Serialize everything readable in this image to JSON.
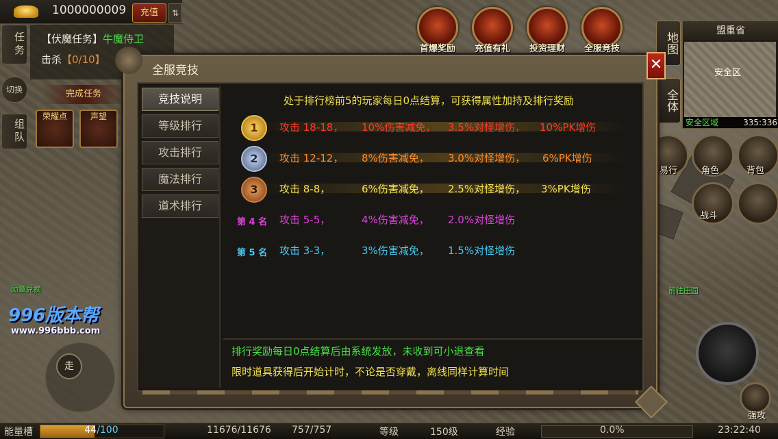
{
  "hud": {
    "gold_amount": "1000000009",
    "recharge_label": "充值",
    "swap_icon": "⇅"
  },
  "quest": {
    "side_tabs": [
      "任务",
      "切换",
      "组队"
    ],
    "title_prefix": "【伏魔任务】",
    "title_target": "牛魔侍卫",
    "kill_label": "击杀",
    "kill_count": "【0/10】",
    "complete_label": "完成任务",
    "icon1": "荣耀点",
    "icon2": "声望"
  },
  "activities": [
    {
      "label": "首爆奖励",
      "icon": "first-drop-icon"
    },
    {
      "label": "充值有礼",
      "icon": "recharge-gift-icon"
    },
    {
      "label": "投资理财",
      "icon": "invest-icon"
    },
    {
      "label": "全服竞技",
      "icon": "server-arena-icon"
    }
  ],
  "minimap": {
    "side_buttons": [
      "地图",
      "全体"
    ],
    "region_name": "盟重省",
    "safe_label": "安全区",
    "zone_status": "安全区域",
    "coords": "335:336"
  },
  "right_buttons": [
    "交易行",
    "角色",
    "背包",
    "战斗",
    "强攻"
  ],
  "walk_label": "走",
  "npcs": {
    "left": "勋章兑换",
    "right": "前往庄园"
  },
  "logo": {
    "main": "996版本帮",
    "sub": "www.996bbb.com"
  },
  "status_bar": {
    "energy_label": "能量槽",
    "energy_current": "44",
    "energy_max": "/100",
    "energy_fraction": 0.44,
    "hp": "11676/11676",
    "mp": "757/757",
    "level_label": "等级",
    "level_value": "150级",
    "exp_label": "经验",
    "exp_value": "0.0%",
    "time": "23:22:40"
  },
  "dialog": {
    "title": "全服竞技",
    "close_icon": "✕",
    "tabs": [
      "竞技说明",
      "等级排行",
      "攻击排行",
      "魔法排行",
      "道术排行"
    ],
    "active_tab": 0,
    "description": "处于排行榜前5的玩家每日0点结算，可获得属性加持及排行奖励",
    "ranks": [
      {
        "badge": "1",
        "attack": "攻击 18-18，",
        "reduction": "10%伤害减免，",
        "monster": "3.5%对怪增伤，",
        "pk": "10%PK增伤",
        "color": "#ff3a2a"
      },
      {
        "badge": "2",
        "attack": "攻击 12-12，",
        "reduction": "8%伤害减免，",
        "monster": "3.0%对怪增伤，",
        "pk": "6%PK增伤",
        "color": "#ff8a2a"
      },
      {
        "badge": "3",
        "attack": "攻击 8-8，",
        "reduction": "6%伤害减免，",
        "monster": "2.5%对怪增伤，",
        "pk": "3%PK增伤",
        "color": "#f0e050"
      },
      {
        "badge": "第 4 名",
        "attack": "攻击 5-5，",
        "reduction": "4%伤害减免，",
        "monster": "2.0%对怪增伤",
        "pk": "",
        "color": "#e040e0"
      },
      {
        "badge": "第 5 名",
        "attack": "攻击 3-3，",
        "reduction": "3%伤害减免，",
        "monster": "1.5%对怪增伤",
        "pk": "",
        "color": "#48c8f0"
      }
    ],
    "footer_line1": "排行奖励每日0点结算后由系统发放，未收到可小退查看",
    "footer_line2": "限时道具获得后开始计时，不论是否穿戴，离线同样计算时间"
  }
}
